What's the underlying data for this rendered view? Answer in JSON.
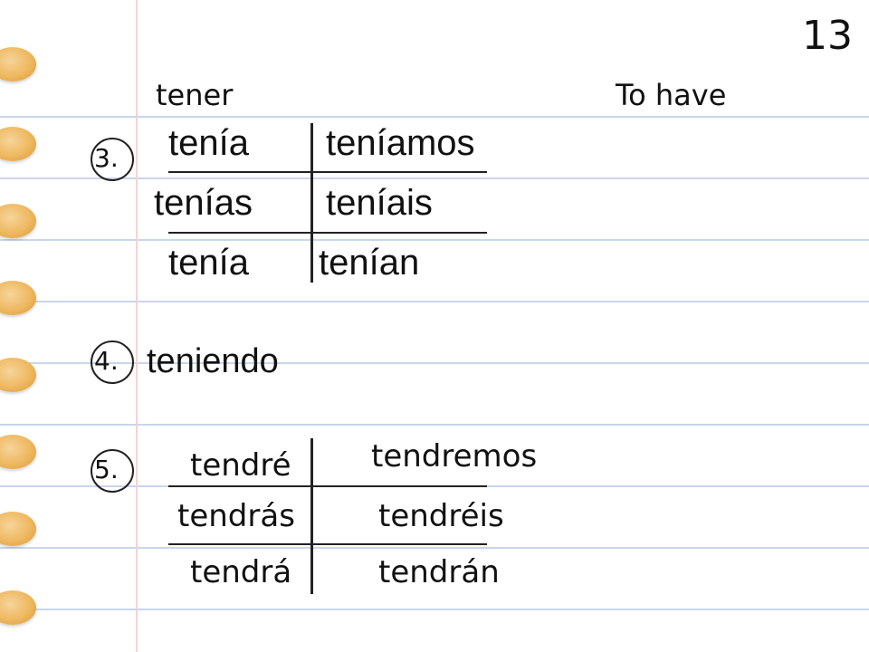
{
  "slide_number": "13",
  "verb": {
    "infinitive": "tener",
    "meaning": "To have"
  },
  "sections": {
    "imperfect": {
      "number": "3.",
      "forms": [
        "tenía",
        "teníamos",
        "tenías",
        "teníais",
        "tenía",
        "tenían"
      ]
    },
    "gerund": {
      "number": "4.",
      "form": "teniendo"
    },
    "future": {
      "number": "5.",
      "forms": [
        "tendré",
        "tendremos",
        "tendrás",
        "tendréis",
        "tendrá",
        "tendrán"
      ]
    }
  },
  "colors": {
    "ruled_line": "#c9d6ea",
    "binder_hole": "#eeb85f",
    "margin_line": "#f3d3d3"
  }
}
